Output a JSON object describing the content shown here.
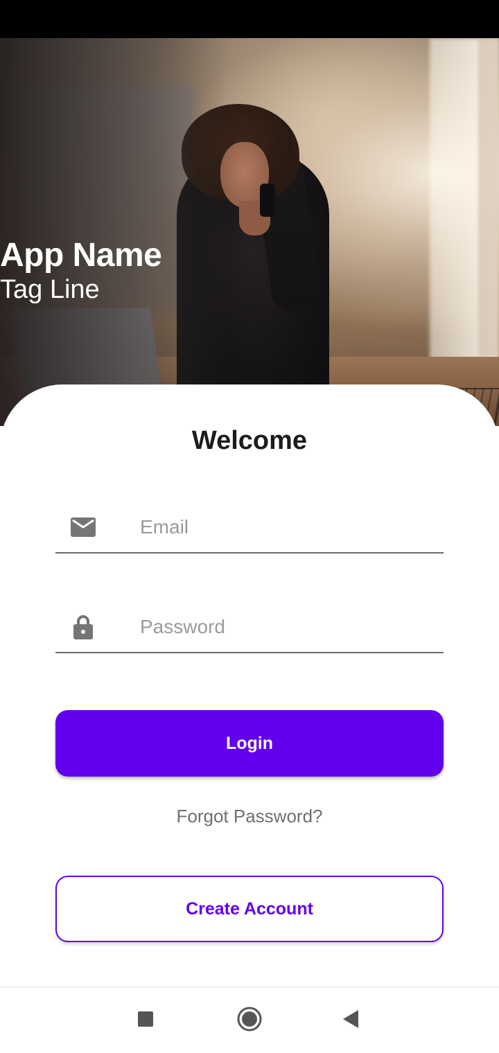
{
  "hero": {
    "app_name": "App Name",
    "tagline": "Tag Line"
  },
  "login_card": {
    "title": "Welcome",
    "email": {
      "placeholder": "Email",
      "value": "",
      "icon": "mail-icon"
    },
    "password": {
      "placeholder": "Password",
      "value": "",
      "icon": "lock-icon"
    },
    "login_label": "Login",
    "forgot_label": "Forgot Password?",
    "create_label": "Create Account"
  },
  "navigation": {
    "recents_icon": "square-icon",
    "home_icon": "circle-icon",
    "back_icon": "triangle-back-icon"
  },
  "colors": {
    "primary": "#6200ee",
    "text_dark": "#1c1c1c",
    "text_muted": "#6f6f6f",
    "icon_gray": "#757575"
  }
}
